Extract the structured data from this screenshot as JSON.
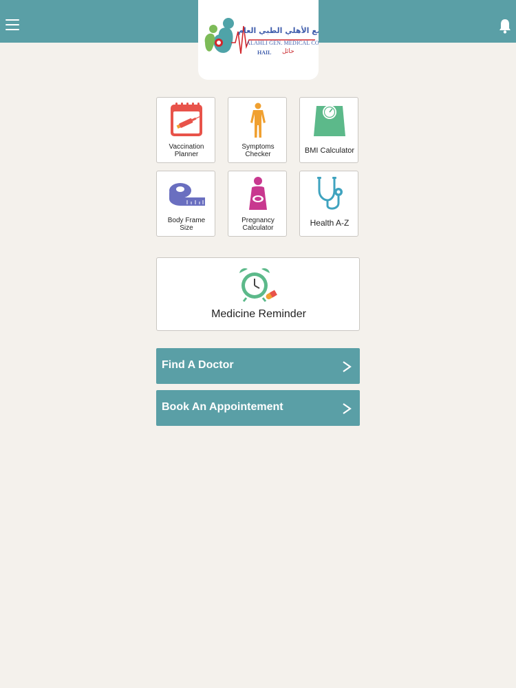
{
  "header": {
    "menu_icon": "hamburger-menu-icon",
    "bell_icon": "bell-icon",
    "logo": {
      "arabic_name": "مجمع الأهلي الطبي العام",
      "english_name": "ALAHLI GEN. MEDICAL COMPLEX",
      "city_en": "HAIL",
      "city_ar": "حائل"
    }
  },
  "tiles": [
    {
      "label_line1": "Vaccination",
      "label_line2": "Planner",
      "icon": "vaccination-calendar-icon"
    },
    {
      "label_line1": "Symptoms",
      "label_line2": "Checker",
      "icon": "human-body-icon"
    },
    {
      "label": "BMI Calculator",
      "icon": "weight-scale-icon"
    },
    {
      "label_line1": "Body Frame",
      "label_line2": "Size",
      "icon": "measuring-tape-icon"
    },
    {
      "label_line1": "Pregnancy",
      "label_line2": "Calculator",
      "icon": "pregnant-woman-icon"
    },
    {
      "label": "Health A-Z",
      "icon": "stethoscope-icon"
    }
  ],
  "reminder": {
    "label": "Medicine Reminder",
    "icon": "alarm-clock-pill-icon"
  },
  "actions": [
    {
      "label": "Find A Doctor",
      "icon": "chevron-right-icon"
    },
    {
      "label": "Book An Appointement",
      "icon": "chevron-right-icon"
    }
  ],
  "colors": {
    "brand_teal": "#5a9fa6",
    "background": "#f4f1ec",
    "accent_red": "#e8534a",
    "accent_orange": "#f0a030",
    "accent_green": "#5cb98a",
    "accent_purple": "#6a6fc0",
    "accent_magenta": "#c8388f"
  }
}
